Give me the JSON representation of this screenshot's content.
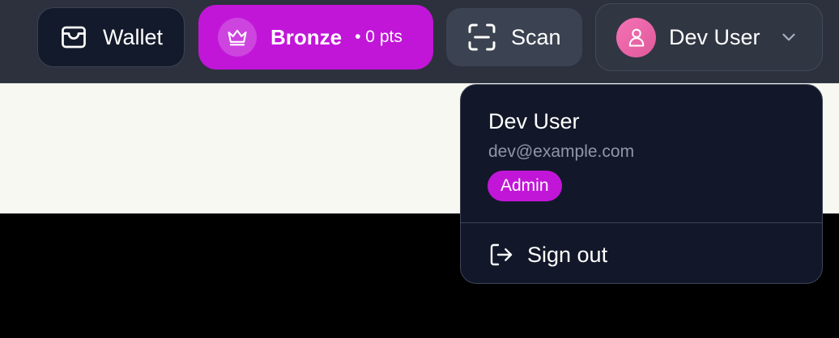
{
  "header": {
    "wallet_label": "Wallet",
    "tier_label": "Bronze",
    "tier_points": "• 0 pts",
    "scan_label": "Scan",
    "user_name": "Dev User"
  },
  "user_menu": {
    "name": "Dev User",
    "email": "dev@example.com",
    "role_badge": "Admin",
    "sign_out_label": "Sign out"
  },
  "icons": {
    "wallet": "wallet-icon",
    "tier": "crown-icon",
    "scan": "scan-icon",
    "avatar": "user-icon",
    "menu_toggle": "chevron-down-icon",
    "sign_out": "log-out-icon"
  },
  "colors": {
    "topbar": "#2d313d",
    "accent": "#c116d8",
    "menu_bg": "#121829",
    "page_light": "#f6f8f1"
  }
}
